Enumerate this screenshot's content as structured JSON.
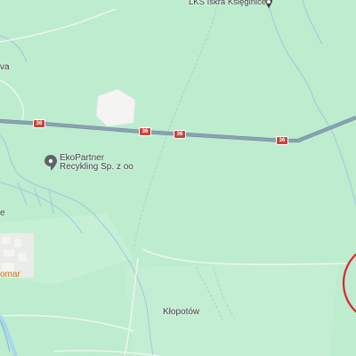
{
  "map": {
    "colors": {
      "land": "#bdeccf",
      "farmland": "#c5f0d5",
      "building": "#f4f4f2",
      "water": "#a8d6ee",
      "stream": "#9fc7e2",
      "road": "#8aa3b3",
      "road_edge": "#7a94a6",
      "highway_shield": "#c5463c",
      "highlight_circle": "#d8282e"
    },
    "road": {
      "number": "36"
    },
    "places": {
      "stadium": "LKS Iskra Księginice",
      "recycling_line1": "EkoPartner",
      "recycling_line2": "Recykling Sp. z oo",
      "village": "Kłopotów",
      "cut_left_top": "va",
      "cut_left_mid": "e",
      "cut_poi_orange": "omar"
    },
    "icons": {
      "stadium_pin": "location-pin-icon",
      "recycling_pin": "location-pin-icon"
    }
  }
}
